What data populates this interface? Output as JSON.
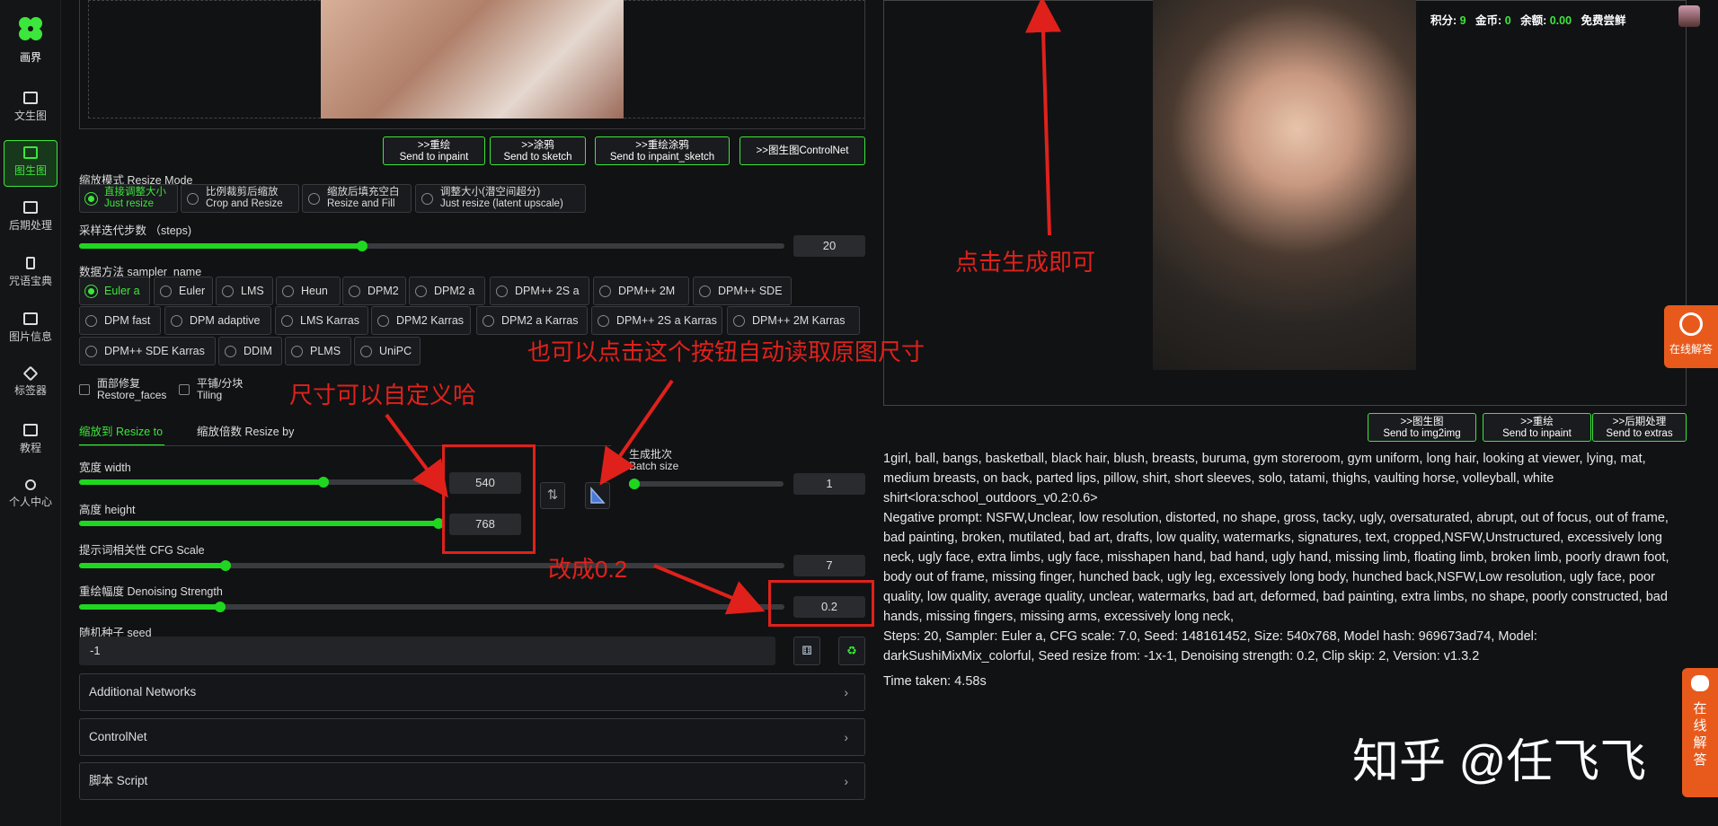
{
  "sidebar": {
    "logo_text": "画界",
    "items": [
      {
        "label": "文生图"
      },
      {
        "label": "图生图"
      },
      {
        "label": "后期处理"
      },
      {
        "label": "咒语宝典"
      },
      {
        "label": "图片信息"
      },
      {
        "label": "标签器"
      },
      {
        "label": "教程"
      },
      {
        "label": "个人中心"
      }
    ]
  },
  "header": {
    "points_label": "积分:",
    "points_value": "9",
    "gold_label": "金币:",
    "gold_value": "0",
    "balance_label": "余额:",
    "balance_value": "0.00",
    "trial": "免费尝鲜"
  },
  "send_buttons": [
    {
      "line1": ">>重绘",
      "line2": "Send to inpaint"
    },
    {
      "line1": ">>涂鸦",
      "line2": "Send to sketch"
    },
    {
      "line1": ">>重绘涂鸦",
      "line2": "Send to inpaint_sketch"
    },
    {
      "line1": ">>图生图ControlNet",
      "line2": ""
    }
  ],
  "resize_mode": {
    "label": "缩放模式 Resize Mode",
    "options": [
      {
        "cn": "直接调整大小",
        "en": "Just resize"
      },
      {
        "cn": "比例裁剪后缩放",
        "en": "Crop and Resize"
      },
      {
        "cn": "缩放后填充空白",
        "en": "Resize and Fill"
      },
      {
        "cn": "调整大小(潜空间超分)",
        "en": "Just resize (latent upscale)"
      }
    ]
  },
  "steps": {
    "label": "采样迭代步数 （steps)",
    "value": "20"
  },
  "sampler": {
    "label": "数据方法 sampler_name",
    "row1": [
      "Euler a",
      "Euler",
      "LMS",
      "Heun",
      "DPM2",
      "DPM2 a",
      "DPM++ 2S a",
      "DPM++ 2M",
      "DPM++ SDE"
    ],
    "row2": [
      "DPM fast",
      "DPM adaptive",
      "LMS Karras",
      "DPM2 Karras",
      "DPM2 a Karras",
      "DPM++ 2S a Karras",
      "DPM++ 2M Karras"
    ],
    "row3": [
      "DPM++ SDE Karras",
      "DDIM",
      "PLMS",
      "UniPC"
    ]
  },
  "restore_faces": {
    "cn": "面部修复",
    "en": "Restore_faces"
  },
  "tiling": {
    "cn": "平铺/分块",
    "en": "Tiling"
  },
  "tabs": {
    "resize_to": "缩放到 Resize to",
    "resize_by": "缩放倍数 Resize by"
  },
  "width": {
    "label": "宽度 width",
    "value": "540",
    "fraction": 0.31
  },
  "height": {
    "label": "高度 height",
    "value": "768",
    "fraction": 0.47
  },
  "batch_size": {
    "cn": "生成批次",
    "en": "Batch size",
    "value": "1"
  },
  "cfg": {
    "label": "提示词相关性 CFG Scale",
    "value": "7"
  },
  "denoise": {
    "label": "重绘幅度 Denoising Strength",
    "value": "0.2"
  },
  "seed": {
    "label": "随机种子 seed",
    "value": "-1"
  },
  "accordions": [
    "Additional Networks",
    "ControlNet",
    "脚本 Script"
  ],
  "annotations": {
    "click_generate": "点击生成即可",
    "auto_read": "也可以点击这个按钮自动读取原图尺寸",
    "custom_size": "尺寸可以自定义哈",
    "change_to": "改成0.2"
  },
  "output_buttons": [
    {
      "line1": ">>图生图",
      "line2": "Send to img2img"
    },
    {
      "line1": ">>重绘",
      "line2": "Send to inpaint"
    },
    {
      "line1": ">>后期处理",
      "line2": "Send to extras"
    }
  ],
  "generation_info": {
    "prompt": "1girl, ball, bangs, basketball, black hair, blush, breasts, buruma, gym storeroom, gym uniform, long hair, looking at viewer, lying, mat, medium breasts, on back, parted lips, pillow, shirt, short sleeves, solo, tatami, thighs, vaulting horse, volleyball, white shirt<lora:school_outdoors_v0.2:0.6>",
    "negative": "Negative prompt: NSFW,Unclear, low resolution, distorted, no shape, gross, tacky, ugly, oversaturated, abrupt, out of focus, out of frame, bad painting, broken, mutilated, bad art, drafts, low quality, watermarks, signatures, text, cropped,NSFW,Unstructured, excessively long neck, ugly face, extra limbs, ugly face, misshapen hand, bad hand, ugly hand, missing limb, floating limb, broken limb, poorly drawn foot, body out of frame, missing finger, hunched back, ugly leg, excessively long body, hunched back,NSFW,Low resolution, ugly face, poor quality, low quality, average quality, unclear, watermarks, bad art, deformed, bad painting, extra limbs, no shape, poorly constructed, bad hands, missing fingers, missing arms, excessively long neck,",
    "params": "Steps: 20, Sampler: Euler a, CFG scale: 7.0, Seed: 148161452, Size: 540x768, Model hash: 969673ad74, Model: darkSushiMixMix_colorful, Seed resize from: -1x-1, Denoising strength: 0.2, Clip skip: 2, Version: v1.3.2",
    "time": "Time taken: 4.58s"
  },
  "online_help": "在线解答",
  "online_help_vertical": "在线解答",
  "watermark": "知乎 @任飞飞",
  "colors": {
    "accent": "#3ce63c",
    "annotation": "#e0211b",
    "help_tab": "#e85a1c"
  }
}
